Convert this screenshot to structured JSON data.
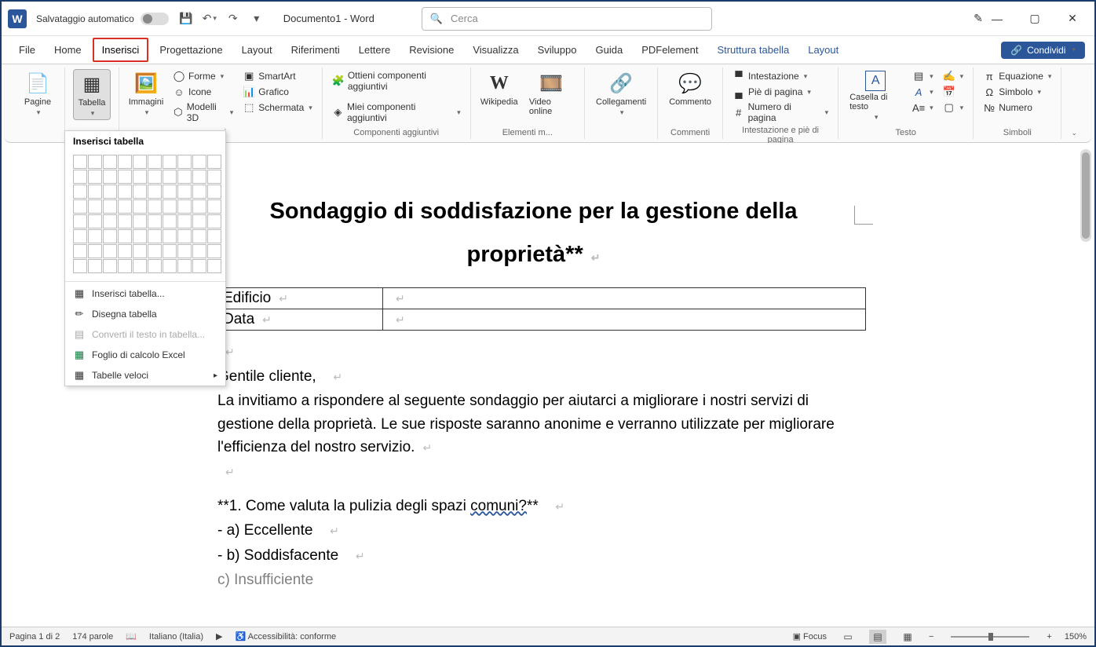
{
  "titlebar": {
    "autosave_label": "Salvataggio automatico",
    "doc_title": "Documento1 - Word",
    "search_placeholder": "Cerca"
  },
  "tabs": {
    "file": "File",
    "home": "Home",
    "insert": "Inserisci",
    "design": "Progettazione",
    "layout": "Layout",
    "references": "Riferimenti",
    "mailings": "Lettere",
    "review": "Revisione",
    "view": "Visualizza",
    "developer": "Sviluppo",
    "help": "Guida",
    "pdfelement": "PDFelement",
    "table_design": "Struttura tabella",
    "table_layout": "Layout",
    "share": "Condividi"
  },
  "ribbon": {
    "pages": {
      "label": "Pagine"
    },
    "table": {
      "label": "Tabella"
    },
    "images": {
      "label": "Immagini"
    },
    "illustrations": {
      "shapes": "Forme",
      "icons": "Icone",
      "models3d": "Modelli 3D",
      "smartart": "SmartArt",
      "chart": "Grafico",
      "screenshot": "Schermata"
    },
    "addins": {
      "get": "Ottieni componenti aggiuntivi",
      "my": "Miei componenti aggiuntivi",
      "group": "Componenti aggiuntivi"
    },
    "media": {
      "wikipedia": "Wikipedia",
      "video": "Video online",
      "group": "Elementi m..."
    },
    "links": {
      "label": "Collegamenti"
    },
    "comments": {
      "label": "Commento",
      "group": "Commenti"
    },
    "headerfooter": {
      "header": "Intestazione",
      "footer": "Piè di pagina",
      "pagenum": "Numero di pagina",
      "group": "Intestazione e piè di pagina"
    },
    "text": {
      "textbox": "Casella di testo",
      "group": "Testo"
    },
    "symbols": {
      "equation": "Equazione",
      "symbol": "Simbolo",
      "number": "Numero",
      "group": "Simboli"
    }
  },
  "dropdown": {
    "title": "Inserisci tabella",
    "insert": "Inserisci tabella...",
    "draw": "Disegna tabella",
    "convert": "Converti il testo in tabella...",
    "excel": "Foglio di calcolo Excel",
    "quick": "Tabelle veloci"
  },
  "document": {
    "heading": "Sondaggio di soddisfazione per la gestione della proprietà**",
    "table": {
      "r1c1": "Edificio",
      "r2c1": "Data"
    },
    "greeting": "Gentile cliente,",
    "intro": "La invitiamo a rispondere al seguente sondaggio per aiutarci a migliorare i nostri servizi di gestione della proprietà. Le sue risposte saranno anonime e verranno utilizzate per migliorare l'efficienza del nostro servizio.",
    "q1_prefix": "**1. Come valuta la pulizia degli spazi ",
    "q1_underlined": "comuni?",
    "q1_suffix": "**",
    "a1": "- a) Eccellente",
    "a2": "- b) Soddisfacente",
    "a3": "c) Insufficiente"
  },
  "statusbar": {
    "page": "Pagina 1 di 2",
    "words": "174 parole",
    "lang": "Italiano (Italia)",
    "accessibility": "Accessibilità: conforme",
    "focus": "Focus",
    "zoom": "150%"
  }
}
